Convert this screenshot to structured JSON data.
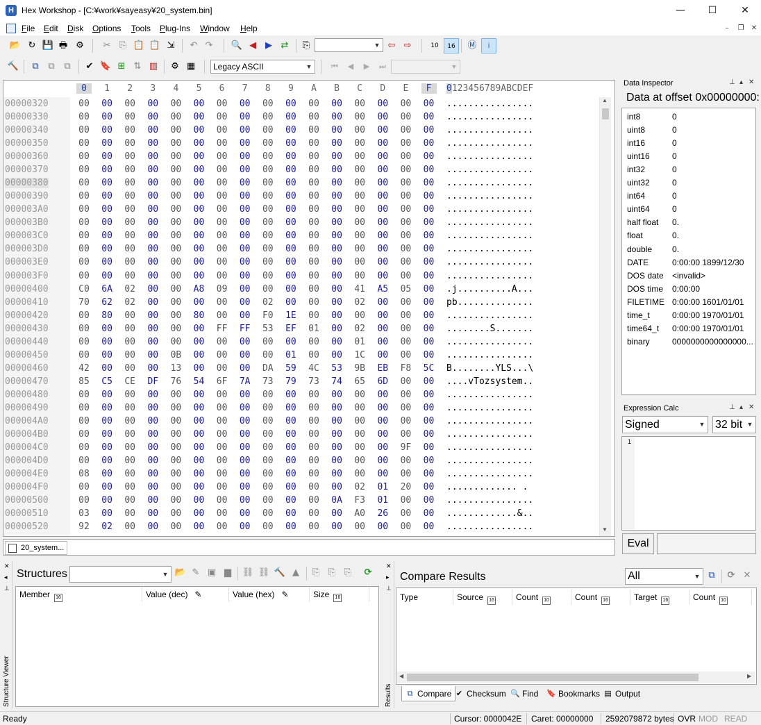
{
  "window": {
    "title": "Hex Workshop - [C:¥work¥sayeasy¥20_system.bin]",
    "app_icon_letter": "H",
    "minimize": "—",
    "maximize": "☐",
    "close": "✕"
  },
  "menu": {
    "items": [
      "File",
      "Edit",
      "Disk",
      "Options",
      "Tools",
      "Plug-Ins",
      "Window",
      "Help"
    ],
    "mdi_min": "–",
    "mdi_restore": "❐",
    "mdi_close": "✕"
  },
  "toolbar": {
    "icons": {
      "open": "📂",
      "reopen": "↻",
      "save": "💾",
      "print": "🖶",
      "properties": "⚙",
      "cut": "✂",
      "copy": "⎘",
      "paste": "📋",
      "paste_special": "📋",
      "export": "⇲",
      "undo": "↶",
      "redo": "↷",
      "find": "🔍",
      "find_prev": "◀",
      "find_next": "▶",
      "replace": "⇄",
      "goto": "⎘",
      "goto_prev": "⇦",
      "goto_next": "⇨",
      "base10": "10",
      "base16": "16",
      "motorola": "Ⓜ",
      "intel": "i"
    },
    "goto_value": "",
    "character_set": "Legacy ASCII",
    "record_select_value": "",
    "tools_icons": {
      "hammer": "🔨",
      "compare": "⧉",
      "compare2": "⧉",
      "compare3": "⧉",
      "checksum": "✔",
      "bookmark": "🔖",
      "structure": "⊞",
      "operations": "⇅",
      "stats": "▥",
      "settings": "⚙",
      "calculator": "▦"
    },
    "record_nav": {
      "first": "⏮",
      "prev": "◀",
      "next": "▶",
      "last": "⏭"
    }
  },
  "hex": {
    "columns": [
      "0",
      "1",
      "2",
      "3",
      "4",
      "5",
      "6",
      "7",
      "8",
      "9",
      "A",
      "B",
      "C",
      "D",
      "E",
      "F"
    ],
    "ascii_header": "0123456789ABCDEF",
    "ascii_header_first": "0",
    "ascii_header_rest": "123456789ABCDEF",
    "current_offset": "00000380",
    "rows": [
      {
        "offset": "00000320",
        "bytes": [
          "00",
          "00",
          "00",
          "00",
          "00",
          "00",
          "00",
          "00",
          "00",
          "00",
          "00",
          "00",
          "00",
          "00",
          "00",
          "00"
        ],
        "ascii": "................"
      },
      {
        "offset": "00000330",
        "bytes": [
          "00",
          "00",
          "00",
          "00",
          "00",
          "00",
          "00",
          "00",
          "00",
          "00",
          "00",
          "00",
          "00",
          "00",
          "00",
          "00"
        ],
        "ascii": "................"
      },
      {
        "offset": "00000340",
        "bytes": [
          "00",
          "00",
          "00",
          "00",
          "00",
          "00",
          "00",
          "00",
          "00",
          "00",
          "00",
          "00",
          "00",
          "00",
          "00",
          "00"
        ],
        "ascii": "................"
      },
      {
        "offset": "00000350",
        "bytes": [
          "00",
          "00",
          "00",
          "00",
          "00",
          "00",
          "00",
          "00",
          "00",
          "00",
          "00",
          "00",
          "00",
          "00",
          "00",
          "00"
        ],
        "ascii": "................"
      },
      {
        "offset": "00000360",
        "bytes": [
          "00",
          "00",
          "00",
          "00",
          "00",
          "00",
          "00",
          "00",
          "00",
          "00",
          "00",
          "00",
          "00",
          "00",
          "00",
          "00"
        ],
        "ascii": "................"
      },
      {
        "offset": "00000370",
        "bytes": [
          "00",
          "00",
          "00",
          "00",
          "00",
          "00",
          "00",
          "00",
          "00",
          "00",
          "00",
          "00",
          "00",
          "00",
          "00",
          "00"
        ],
        "ascii": "................"
      },
      {
        "offset": "00000380",
        "bytes": [
          "00",
          "00",
          "00",
          "00",
          "00",
          "00",
          "00",
          "00",
          "00",
          "00",
          "00",
          "00",
          "00",
          "00",
          "00",
          "00"
        ],
        "ascii": "................"
      },
      {
        "offset": "00000390",
        "bytes": [
          "00",
          "00",
          "00",
          "00",
          "00",
          "00",
          "00",
          "00",
          "00",
          "00",
          "00",
          "00",
          "00",
          "00",
          "00",
          "00"
        ],
        "ascii": "................"
      },
      {
        "offset": "000003A0",
        "bytes": [
          "00",
          "00",
          "00",
          "00",
          "00",
          "00",
          "00",
          "00",
          "00",
          "00",
          "00",
          "00",
          "00",
          "00",
          "00",
          "00"
        ],
        "ascii": "................"
      },
      {
        "offset": "000003B0",
        "bytes": [
          "00",
          "00",
          "00",
          "00",
          "00",
          "00",
          "00",
          "00",
          "00",
          "00",
          "00",
          "00",
          "00",
          "00",
          "00",
          "00"
        ],
        "ascii": "................"
      },
      {
        "offset": "000003C0",
        "bytes": [
          "00",
          "00",
          "00",
          "00",
          "00",
          "00",
          "00",
          "00",
          "00",
          "00",
          "00",
          "00",
          "00",
          "00",
          "00",
          "00"
        ],
        "ascii": "................"
      },
      {
        "offset": "000003D0",
        "bytes": [
          "00",
          "00",
          "00",
          "00",
          "00",
          "00",
          "00",
          "00",
          "00",
          "00",
          "00",
          "00",
          "00",
          "00",
          "00",
          "00"
        ],
        "ascii": "................"
      },
      {
        "offset": "000003E0",
        "bytes": [
          "00",
          "00",
          "00",
          "00",
          "00",
          "00",
          "00",
          "00",
          "00",
          "00",
          "00",
          "00",
          "00",
          "00",
          "00",
          "00"
        ],
        "ascii": "................"
      },
      {
        "offset": "000003F0",
        "bytes": [
          "00",
          "00",
          "00",
          "00",
          "00",
          "00",
          "00",
          "00",
          "00",
          "00",
          "00",
          "00",
          "00",
          "00",
          "00",
          "00"
        ],
        "ascii": "................"
      },
      {
        "offset": "00000400",
        "bytes": [
          "C0",
          "6A",
          "02",
          "00",
          "00",
          "A8",
          "09",
          "00",
          "00",
          "00",
          "00",
          "00",
          "41",
          "A5",
          "05",
          "00"
        ],
        "ascii": ".j..........A..."
      },
      {
        "offset": "00000410",
        "bytes": [
          "70",
          "62",
          "02",
          "00",
          "00",
          "00",
          "00",
          "00",
          "02",
          "00",
          "00",
          "00",
          "02",
          "00",
          "00",
          "00"
        ],
        "ascii": "pb.............."
      },
      {
        "offset": "00000420",
        "bytes": [
          "00",
          "80",
          "00",
          "00",
          "00",
          "80",
          "00",
          "00",
          "F0",
          "1E",
          "00",
          "00",
          "00",
          "00",
          "00",
          "00"
        ],
        "ascii": "................"
      },
      {
        "offset": "00000430",
        "bytes": [
          "00",
          "00",
          "00",
          "00",
          "00",
          "00",
          "FF",
          "FF",
          "53",
          "EF",
          "01",
          "00",
          "02",
          "00",
          "00",
          "00"
        ],
        "ascii": "........S......."
      },
      {
        "offset": "00000440",
        "bytes": [
          "00",
          "00",
          "00",
          "00",
          "00",
          "00",
          "00",
          "00",
          "00",
          "00",
          "00",
          "00",
          "01",
          "00",
          "00",
          "00"
        ],
        "ascii": "................"
      },
      {
        "offset": "00000450",
        "bytes": [
          "00",
          "00",
          "00",
          "00",
          "0B",
          "00",
          "00",
          "00",
          "00",
          "01",
          "00",
          "00",
          "1C",
          "00",
          "00",
          "00"
        ],
        "ascii": "................"
      },
      {
        "offset": "00000460",
        "bytes": [
          "42",
          "00",
          "00",
          "00",
          "13",
          "00",
          "00",
          "00",
          "DA",
          "59",
          "4C",
          "53",
          "9B",
          "EB",
          "F8",
          "5C"
        ],
        "ascii": "B........YLS...\\"
      },
      {
        "offset": "00000470",
        "bytes": [
          "85",
          "C5",
          "CE",
          "DF",
          "76",
          "54",
          "6F",
          "7A",
          "73",
          "79",
          "73",
          "74",
          "65",
          "6D",
          "00",
          "00"
        ],
        "ascii": "....vTozsystem.."
      },
      {
        "offset": "00000480",
        "bytes": [
          "00",
          "00",
          "00",
          "00",
          "00",
          "00",
          "00",
          "00",
          "00",
          "00",
          "00",
          "00",
          "00",
          "00",
          "00",
          "00"
        ],
        "ascii": "................"
      },
      {
        "offset": "00000490",
        "bytes": [
          "00",
          "00",
          "00",
          "00",
          "00",
          "00",
          "00",
          "00",
          "00",
          "00",
          "00",
          "00",
          "00",
          "00",
          "00",
          "00"
        ],
        "ascii": "................"
      },
      {
        "offset": "000004A0",
        "bytes": [
          "00",
          "00",
          "00",
          "00",
          "00",
          "00",
          "00",
          "00",
          "00",
          "00",
          "00",
          "00",
          "00",
          "00",
          "00",
          "00"
        ],
        "ascii": "................"
      },
      {
        "offset": "000004B0",
        "bytes": [
          "00",
          "00",
          "00",
          "00",
          "00",
          "00",
          "00",
          "00",
          "00",
          "00",
          "00",
          "00",
          "00",
          "00",
          "00",
          "00"
        ],
        "ascii": "................"
      },
      {
        "offset": "000004C0",
        "bytes": [
          "00",
          "00",
          "00",
          "00",
          "00",
          "00",
          "00",
          "00",
          "00",
          "00",
          "00",
          "00",
          "00",
          "00",
          "9F",
          "00"
        ],
        "ascii": "................"
      },
      {
        "offset": "000004D0",
        "bytes": [
          "00",
          "00",
          "00",
          "00",
          "00",
          "00",
          "00",
          "00",
          "00",
          "00",
          "00",
          "00",
          "00",
          "00",
          "00",
          "00"
        ],
        "ascii": "................"
      },
      {
        "offset": "000004E0",
        "bytes": [
          "08",
          "00",
          "00",
          "00",
          "00",
          "00",
          "00",
          "00",
          "00",
          "00",
          "00",
          "00",
          "00",
          "00",
          "00",
          "00"
        ],
        "ascii": "................"
      },
      {
        "offset": "000004F0",
        "bytes": [
          "00",
          "00",
          "00",
          "00",
          "00",
          "00",
          "00",
          "00",
          "00",
          "00",
          "00",
          "00",
          "02",
          "01",
          "20",
          "00"
        ],
        "ascii": "............. ."
      },
      {
        "offset": "00000500",
        "bytes": [
          "00",
          "00",
          "00",
          "00",
          "00",
          "00",
          "00",
          "00",
          "00",
          "00",
          "00",
          "0A",
          "F3",
          "01",
          "00",
          "00"
        ],
        "ascii": "................"
      },
      {
        "offset": "00000510",
        "bytes": [
          "03",
          "00",
          "00",
          "00",
          "00",
          "00",
          "00",
          "00",
          "00",
          "00",
          "00",
          "00",
          "A0",
          "26",
          "00",
          "00"
        ],
        "ascii": ".............&.."
      },
      {
        "offset": "00000520",
        "bytes": [
          "92",
          "02",
          "00",
          "00",
          "00",
          "00",
          "00",
          "00",
          "00",
          "00",
          "00",
          "00",
          "00",
          "00",
          "00",
          "00"
        ],
        "ascii": "................"
      }
    ]
  },
  "file_tab": {
    "label": "20_system..."
  },
  "data_inspector": {
    "title": "Data Inspector",
    "heading": "Data at offset 0x00000000:",
    "rows": [
      {
        "name": "int8",
        "value": "0"
      },
      {
        "name": "uint8",
        "value": "0"
      },
      {
        "name": "int16",
        "value": "0"
      },
      {
        "name": "uint16",
        "value": "0"
      },
      {
        "name": "int32",
        "value": "0"
      },
      {
        "name": "uint32",
        "value": "0"
      },
      {
        "name": "int64",
        "value": "0"
      },
      {
        "name": "uint64",
        "value": "0"
      },
      {
        "name": "half float",
        "value": "0."
      },
      {
        "name": "float",
        "value": "0."
      },
      {
        "name": "double",
        "value": "0."
      },
      {
        "name": "DATE",
        "value": "0:00:00 1899/12/30"
      },
      {
        "name": "DOS date",
        "value": "<invalid>"
      },
      {
        "name": "DOS time",
        "value": "0:00:00"
      },
      {
        "name": "FILETIME",
        "value": "0:00:00 1601/01/01"
      },
      {
        "name": "time_t",
        "value": "0:00:00 1970/01/01"
      },
      {
        "name": "time64_t",
        "value": "0:00:00 1970/01/01"
      },
      {
        "name": "binary",
        "value": "0000000000000000..."
      }
    ]
  },
  "expression_calc": {
    "title": "Expression Calc",
    "sign_mode": "Signed",
    "bit_width": "32 bit",
    "line_number": "1",
    "eval_label": "Eval",
    "result": ""
  },
  "structure_viewer": {
    "side_label": "Structure Viewer",
    "title": "Structures",
    "structure_select": "",
    "columns": [
      "Member",
      "Value (dec)",
      "Value (hex)",
      "Size"
    ],
    "icons": {
      "open": "📂",
      "edit": "✎",
      "pin": "▣",
      "folder": "▆",
      "link": "⛓",
      "link2": "⛓",
      "hammer": "🔨",
      "up": "▲",
      "copy1": "⎘",
      "copy2": "⎘",
      "copy3": "⎘",
      "refresh": "⟳"
    }
  },
  "compare_results": {
    "side_label": "Results",
    "title": "Compare Results",
    "filter": "All",
    "columns": [
      "Type",
      "Source",
      "Count",
      "Count",
      "Target",
      "Count"
    ],
    "tabs": [
      {
        "label": "Compare",
        "icon": "⧉"
      },
      {
        "label": "Checksum",
        "icon": "✔"
      },
      {
        "label": "Find",
        "icon": "🔍"
      },
      {
        "label": "Bookmarks",
        "icon": "🔖"
      },
      {
        "label": "Output",
        "icon": "▤"
      }
    ],
    "icons": {
      "export": "⧉",
      "refresh": "⟳",
      "close": "✕"
    }
  },
  "status": {
    "ready": "Ready",
    "cursor": "Cursor: 0000042E",
    "caret": "Caret: 00000000",
    "size": "2592079872 bytes",
    "ovr": "OVR",
    "mod": "MOD",
    "read": "READ"
  }
}
